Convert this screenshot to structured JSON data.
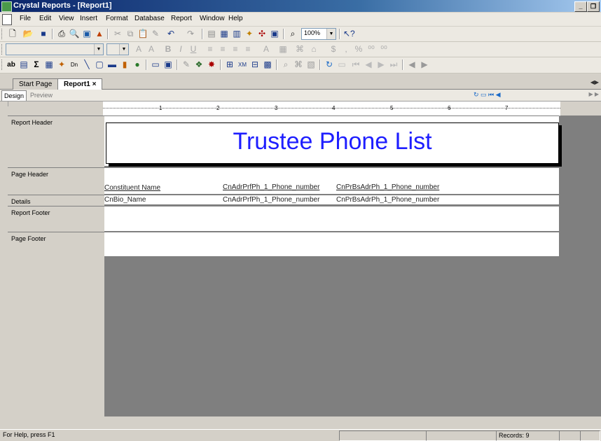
{
  "window": {
    "title": "Crystal Reports - [Report1]"
  },
  "menu": [
    "File",
    "Edit",
    "View",
    "Insert",
    "Format",
    "Database",
    "Report",
    "Window",
    "Help"
  ],
  "toolbar": {
    "zoom": "100%"
  },
  "tabs": {
    "start_page": "Start Page",
    "report": "Report1",
    "close": "×"
  },
  "view_tabs": {
    "design": "Design",
    "preview": "Preview"
  },
  "ruler": [
    "1",
    "2",
    "3",
    "4",
    "5",
    "6",
    "7"
  ],
  "sections": {
    "report_header": "Report Header",
    "page_header": "Page Header",
    "details": "Details",
    "report_footer": "Report Footer",
    "page_footer": "Page Footer"
  },
  "report": {
    "title": "Trustee Phone List",
    "headers": [
      "Constituent Name",
      "CnAdrPrfPh_1_Phone_number",
      "CnPrBsAdrPh_1_Phone_number"
    ],
    "details": [
      "CnBio_Name",
      "CnAdrPrfPh_1_Phone_number",
      "CnPrBsAdrPh_1_Phone_number"
    ]
  },
  "status": {
    "help": "For Help, press F1",
    "records": "Records: 9"
  },
  "icons": {
    "app": "crystal-reports-icon",
    "new": "new-icon",
    "open": "open-icon",
    "save": "save-icon",
    "print": "print-icon",
    "search": "binoculars-icon",
    "help": "help-pointer-icon"
  }
}
